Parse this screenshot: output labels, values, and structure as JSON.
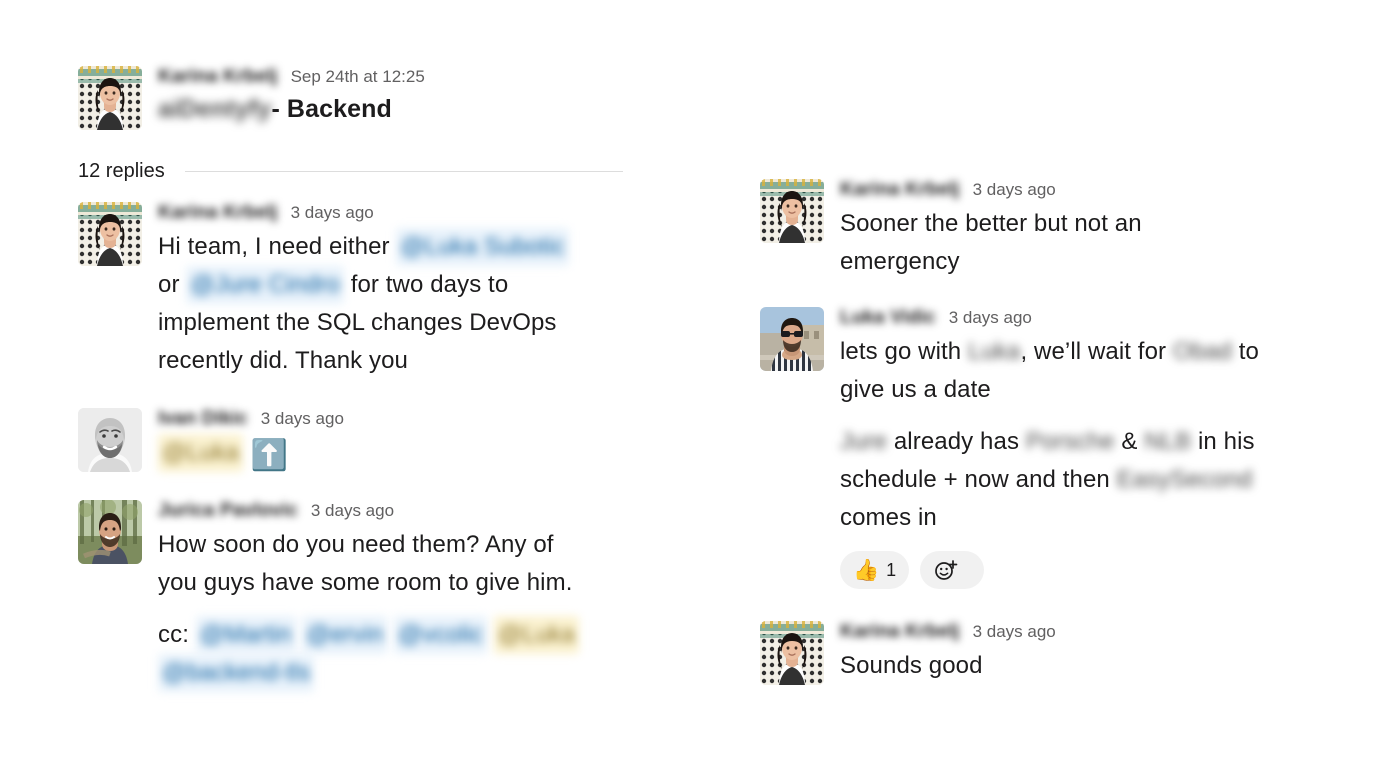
{
  "thread": {
    "root": {
      "author": "Karina Krbelj",
      "author_redacted": true,
      "timestamp": "Sep 24th at 12:25",
      "subject_redacted": "aiDentyfy",
      "subject_suffix": "- Backend",
      "avatar": "woman-tiled-wall-photo"
    },
    "replies_label": "12 replies",
    "messages": [
      {
        "id": "m1",
        "author": "Karina Krbelj",
        "timestamp": "3 days ago",
        "avatar": "woman-tiled-wall-photo",
        "lines": [
          {
            "parts": [
              {
                "t": "text",
                "v": "Hi team, I need either "
              },
              {
                "t": "mention",
                "v": "@Luka Subotic"
              }
            ]
          },
          {
            "parts": [
              {
                "t": "text",
                "v": "or "
              },
              {
                "t": "mention",
                "v": "@Jure Cindro"
              },
              {
                "t": "text",
                "v": " for two days to"
              }
            ]
          },
          {
            "parts": [
              {
                "t": "text",
                "v": "implement the SQL changes DevOps"
              }
            ]
          },
          {
            "parts": [
              {
                "t": "text",
                "v": "recently did. Thank you"
              }
            ]
          }
        ]
      },
      {
        "id": "m2",
        "author": "Ivan Dikic",
        "timestamp": "3 days ago",
        "avatar": "bald-bearded-man-bw-photo",
        "lines": [
          {
            "parts": [
              {
                "t": "self-mention",
                "v": "@Luka"
              },
              {
                "t": "emoji",
                "v": "⬆️",
                "name": "up-arrow-emoji"
              }
            ]
          }
        ]
      },
      {
        "id": "m3",
        "author": "Jurica Pavlovic",
        "timestamp": "3 days ago",
        "avatar": "man-forest-photo",
        "lines": [
          {
            "parts": [
              {
                "t": "text",
                "v": "How soon do you need them?  Any of"
              }
            ]
          },
          {
            "parts": [
              {
                "t": "text",
                "v": "you guys have some room to give  him."
              }
            ]
          },
          {
            "parts": []
          },
          {
            "parts": [
              {
                "t": "text",
                "v": "cc: "
              },
              {
                "t": "mention",
                "v": "@Martin"
              },
              {
                "t": "text",
                "v": " "
              },
              {
                "t": "mention",
                "v": "@ervin"
              },
              {
                "t": "text",
                "v": " "
              },
              {
                "t": "mention",
                "v": "@vcolic"
              },
              {
                "t": "text",
                "v": " "
              },
              {
                "t": "self-mention",
                "v": "@Luka"
              }
            ]
          },
          {
            "parts": [
              {
                "t": "mention",
                "v": "@backend-tls"
              }
            ]
          }
        ]
      },
      {
        "id": "m4",
        "author": "Karina Krbelj",
        "timestamp": "3 days ago",
        "avatar": "woman-tiled-wall-photo",
        "lines": [
          {
            "parts": [
              {
                "t": "text",
                "v": "Sooner the better but not an"
              }
            ]
          },
          {
            "parts": [
              {
                "t": "text",
                "v": "emergency"
              }
            ]
          }
        ]
      },
      {
        "id": "m5",
        "author": "Luka Vidic",
        "timestamp": "3 days ago",
        "avatar": "man-sunglasses-striped-shirt-photo",
        "lines": [
          {
            "parts": [
              {
                "t": "text",
                "v": "lets go with "
              },
              {
                "t": "redact",
                "v": "Luka"
              },
              {
                "t": "text",
                "v": ", we’ll wait for "
              },
              {
                "t": "redact",
                "v": "Obad"
              },
              {
                "t": "text",
                "v": " to"
              }
            ]
          },
          {
            "parts": [
              {
                "t": "text",
                "v": "give us a date"
              }
            ]
          }
        ],
        "followup": {
          "lines": [
            {
              "parts": [
                {
                  "t": "redact",
                  "v": "Jure"
                },
                {
                  "t": "text",
                  "v": " already has "
                },
                {
                  "t": "redact",
                  "v": "Porsche"
                },
                {
                  "t": "text",
                  "v": " & "
                },
                {
                  "t": "redact",
                  "v": "NLB"
                },
                {
                  "t": "text",
                  "v": " in his"
                }
              ]
            },
            {
              "parts": [
                {
                  "t": "text",
                  "v": "schedule + now and then "
                },
                {
                  "t": "redact",
                  "v": "EasySecond"
                }
              ]
            },
            {
              "parts": [
                {
                  "t": "text",
                  "v": "comes in"
                }
              ]
            }
          ],
          "reactions": [
            {
              "emoji": "👍",
              "name": "thumbs-up-emoji",
              "count": "1"
            }
          ],
          "add_reaction_label": "add-reaction"
        }
      },
      {
        "id": "m6",
        "author": "Karina Krbelj",
        "timestamp": "3 days ago",
        "avatar": "woman-tiled-wall-photo",
        "lines": [
          {
            "parts": [
              {
                "t": "text",
                "v": "Sounds good"
              }
            ]
          }
        ]
      }
    ]
  },
  "colors": {
    "mention_text": "#1264a3",
    "mention_bg": "#e8f2fb",
    "self_mention_bg": "#fbf2d0",
    "timestamp": "#616061",
    "body_text": "#1d1c1d",
    "reaction_bg": "#f1f1f1"
  }
}
